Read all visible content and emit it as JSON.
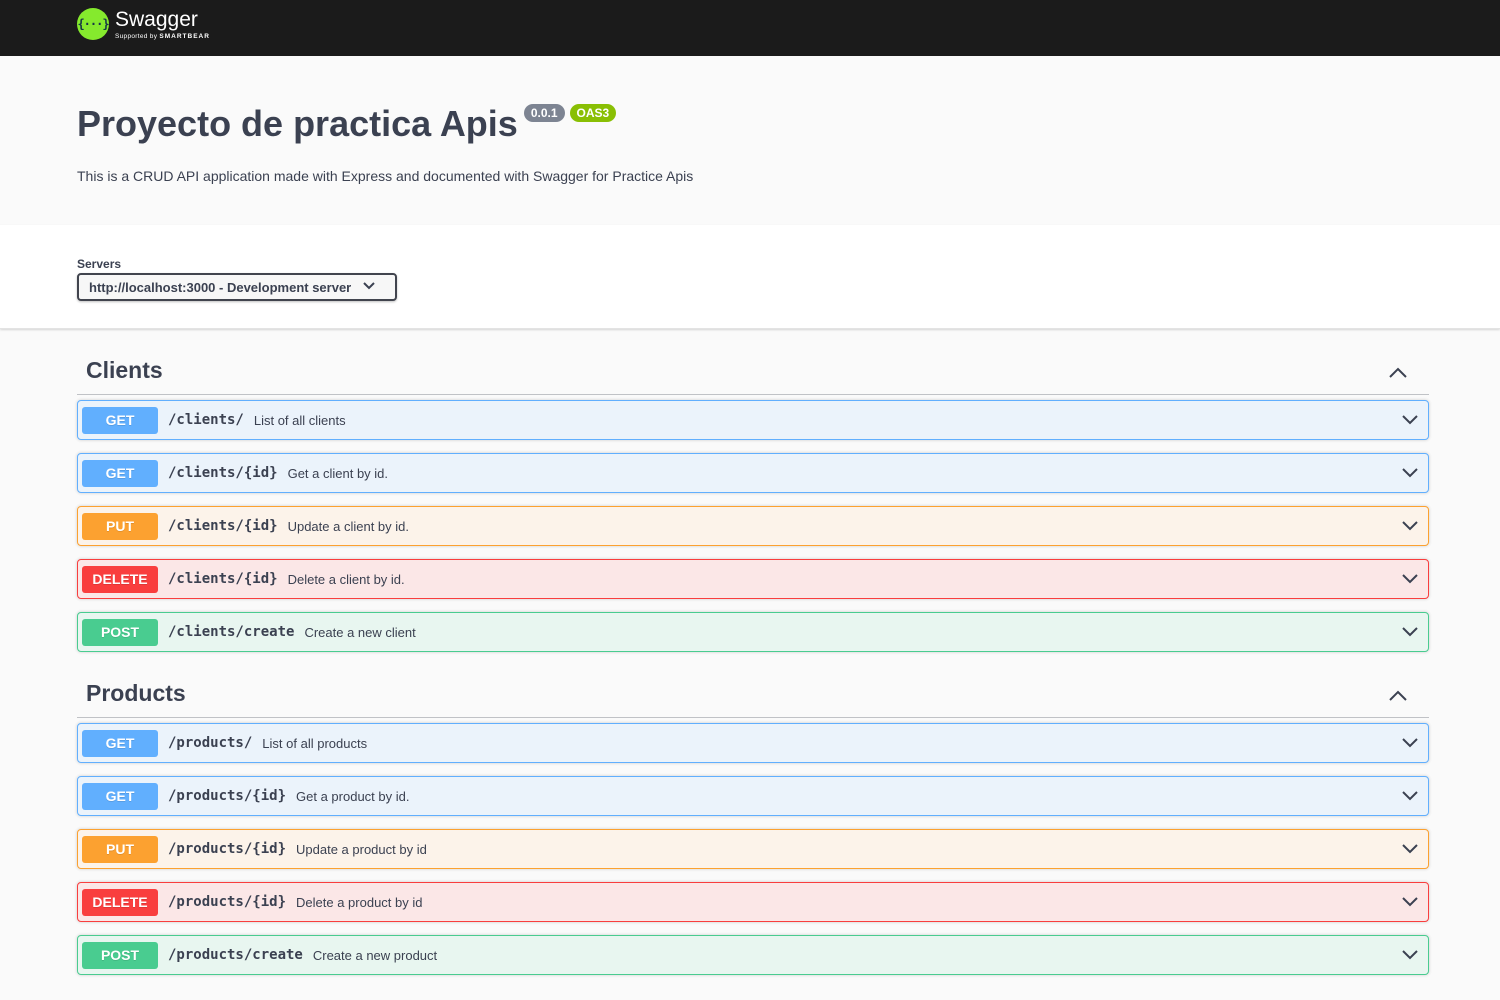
{
  "topbar": {
    "logo_glyph": "{···}",
    "brand_name": "Swagger",
    "brand_sub_prefix": "Supported by",
    "brand_sub_company": "SMARTBEAR"
  },
  "info": {
    "title": "Proyecto de practica Apis",
    "version": "0.0.1",
    "oas_badge": "OAS3",
    "description": "This is a CRUD API application made with Express and documented with Swagger for Practice Apis"
  },
  "servers": {
    "label": "Servers",
    "selected": "http://localhost:3000 - Development server",
    "chevron_icon": "chevron-down-icon"
  },
  "colors": {
    "get": "#61affe",
    "put": "#fca130",
    "delete": "#f93e3e",
    "post": "#49cc90",
    "topbar": "#1b1b1b",
    "logo": "#85ea2d",
    "badge_version": "#7d8492",
    "badge_oas": "#89bf04"
  },
  "tags": [
    {
      "name": "Clients",
      "expanded": true,
      "operations": [
        {
          "method": "GET",
          "path": "/clients/",
          "summary": "List of all clients"
        },
        {
          "method": "GET",
          "path": "/clients/{id}",
          "summary": "Get a client by id."
        },
        {
          "method": "PUT",
          "path": "/clients/{id}",
          "summary": "Update a client by id."
        },
        {
          "method": "DELETE",
          "path": "/clients/{id}",
          "summary": "Delete a client by id."
        },
        {
          "method": "POST",
          "path": "/clients/create",
          "summary": "Create a new client"
        }
      ]
    },
    {
      "name": "Products",
      "expanded": true,
      "operations": [
        {
          "method": "GET",
          "path": "/products/",
          "summary": "List of all products"
        },
        {
          "method": "GET",
          "path": "/products/{id}",
          "summary": "Get a product by id."
        },
        {
          "method": "PUT",
          "path": "/products/{id}",
          "summary": "Update a product by id"
        },
        {
          "method": "DELETE",
          "path": "/products/{id}",
          "summary": "Delete a product by id"
        },
        {
          "method": "POST",
          "path": "/products/create",
          "summary": "Create a new product"
        }
      ]
    }
  ]
}
